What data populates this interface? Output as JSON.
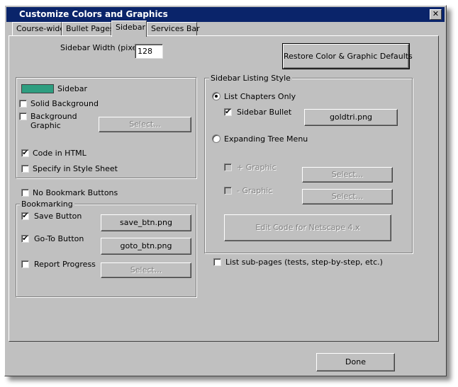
{
  "window": {
    "title": "Customize Colors and Graphics",
    "close_glyph": "✕"
  },
  "tabs": [
    {
      "label": "Course-wide"
    },
    {
      "label": "Bullet Pages"
    },
    {
      "label": "Sidebar",
      "active": true
    },
    {
      "label": "Services Bar"
    }
  ],
  "sidebar_width": {
    "label": "Sidebar Width (pixels)",
    "value": "128"
  },
  "restore_button": "Restore Color & Graphic Defaults",
  "sidebar_group": {
    "sidebar_label": "Sidebar",
    "sidebar_color": "#2e9e80",
    "solid_background": {
      "label": "Solid Background",
      "checked": false
    },
    "background_graphic": {
      "label": "Background\nGraphic",
      "checked": false
    },
    "select_button": "Select...",
    "code_in_html": {
      "label": "Code in HTML",
      "checked": true
    },
    "style_sheet": {
      "label": "Specify in Style Sheet",
      "checked": false
    }
  },
  "no_bookmark_buttons": {
    "label": "No Bookmark Buttons",
    "checked": false
  },
  "bookmarking": {
    "legend": "Bookmarking",
    "save_button": {
      "label": "Save Button",
      "checked": true,
      "file": "save_btn.png"
    },
    "goto_button": {
      "label": "Go-To Button",
      "checked": true,
      "file": "goto_btn.png"
    },
    "report_progress": {
      "label": "Report Progress",
      "checked": false,
      "file": "Select..."
    }
  },
  "listing_style": {
    "legend": "Sidebar Listing Style",
    "list_chapters": {
      "label": "List Chapters Only",
      "selected": true
    },
    "sidebar_bullet": {
      "label": "Sidebar Bullet",
      "checked": true,
      "file": "goldtri.png"
    },
    "expanding_tree": {
      "label": "Expanding Tree Menu",
      "selected": false
    },
    "plus_graphic": {
      "label": "+ Graphic",
      "file": "Select..."
    },
    "minus_graphic": {
      "label": "- Graphic",
      "file": "Select..."
    },
    "netscape_button": "Edit Code for Netscape 4.x"
  },
  "list_subpages": {
    "label": "List sub-pages (tests, step-by-step, etc.)",
    "checked": false
  },
  "done_button": "Done",
  "check_glyph": "✔"
}
